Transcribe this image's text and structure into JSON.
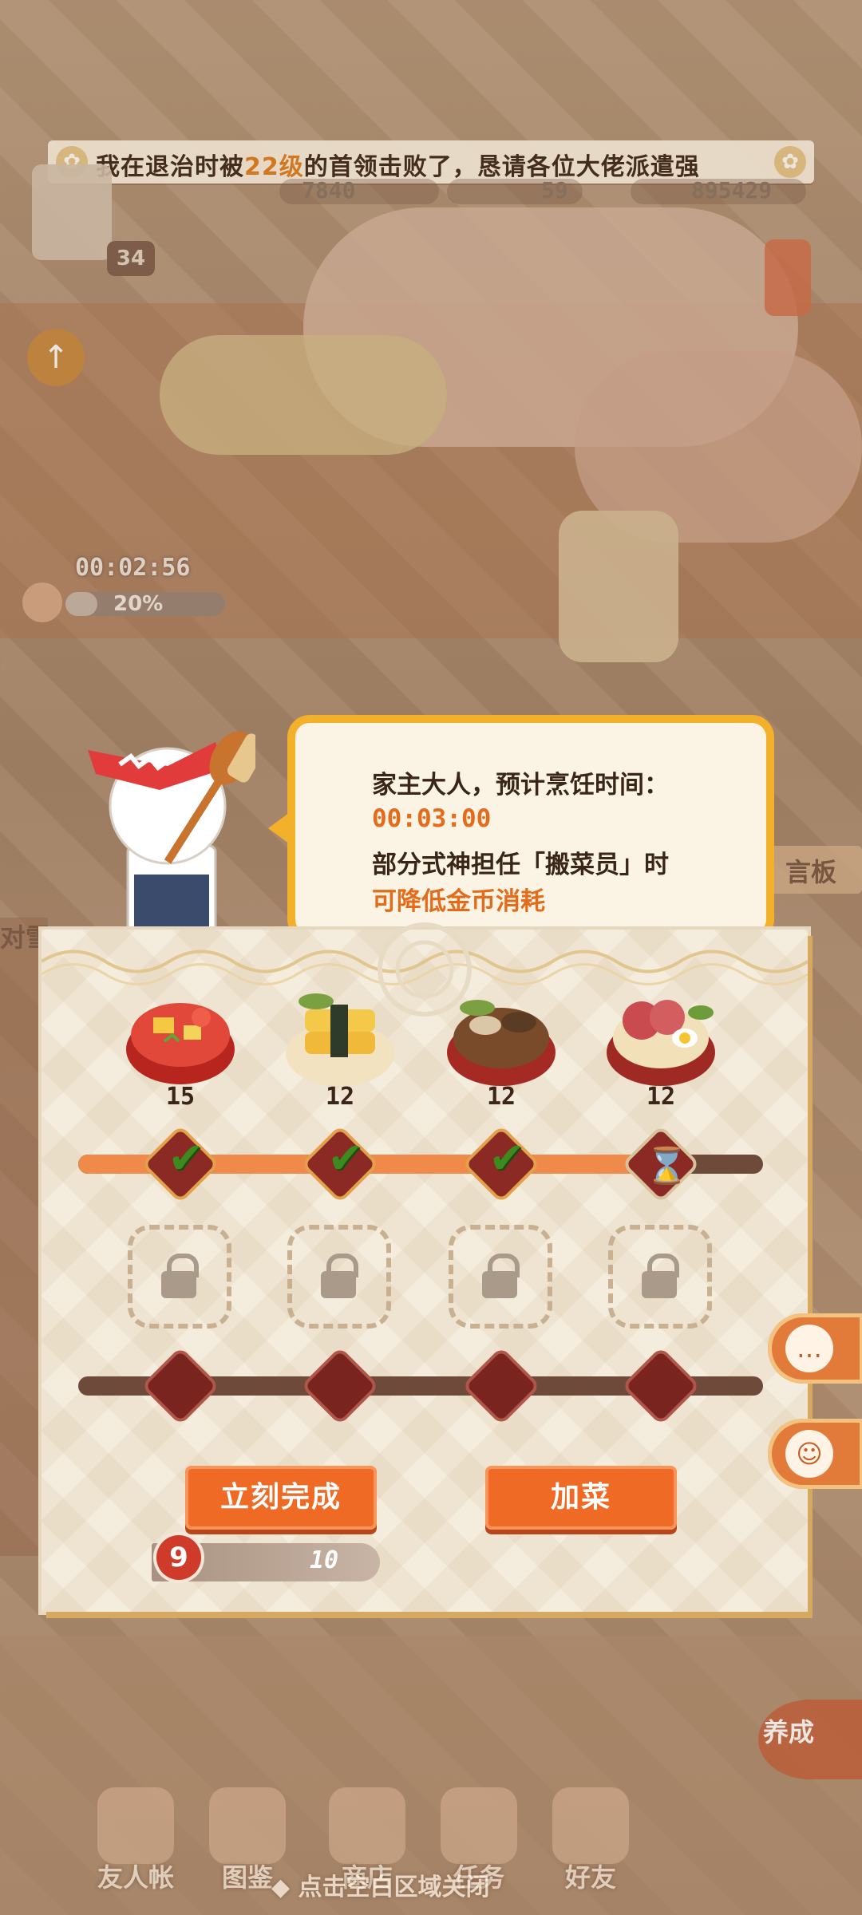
{
  "banner": {
    "pre": "我在退治时被",
    "level": "22级",
    "post": "的首领击败了，恳请各位大佬派遣强"
  },
  "stats": {
    "power": "7840",
    "tickets": "59",
    "coins": "895429"
  },
  "player": {
    "level": "34"
  },
  "cooking": {
    "timer": "00:02:56",
    "progress_text": "20%",
    "progress": 0.2
  },
  "dialog": {
    "line1": "家主大人，预计烹饪时间：",
    "time": "00:03:00",
    "line3": "部分式神担任「搬菜员」时",
    "line4": "可降低金币消耗"
  },
  "dishes": [
    {
      "name": "tomato-soup",
      "count": "15",
      "done": true
    },
    {
      "name": "tamago-sushi",
      "count": "12",
      "done": true
    },
    {
      "name": "mushroom-stew",
      "count": "12",
      "done": true
    },
    {
      "name": "ham-ramen",
      "count": "12",
      "done": false
    }
  ],
  "buttons": {
    "finish_now": "立刻完成",
    "add_dish": "加菜"
  },
  "cost": {
    "icon": "9",
    "value": "10"
  },
  "side": {
    "sign_partial": "言板",
    "left_partial": "对雪"
  },
  "nav": [
    {
      "label": "友人帐",
      "icon": "book-icon"
    },
    {
      "label": "图鉴",
      "icon": "eye-icon"
    },
    {
      "label": "商店",
      "icon": "cat-icon"
    },
    {
      "label": "任务",
      "icon": "task-icon"
    },
    {
      "label": "好友",
      "icon": "friends-icon"
    }
  ],
  "grow_label": "养成",
  "hint": "◆ 点击空白区域关闭",
  "colors": {
    "accent": "#ef6a25",
    "bubble_border": "#f2b02b",
    "highlight": "#e46b1a",
    "check": "#3f8a1f"
  }
}
